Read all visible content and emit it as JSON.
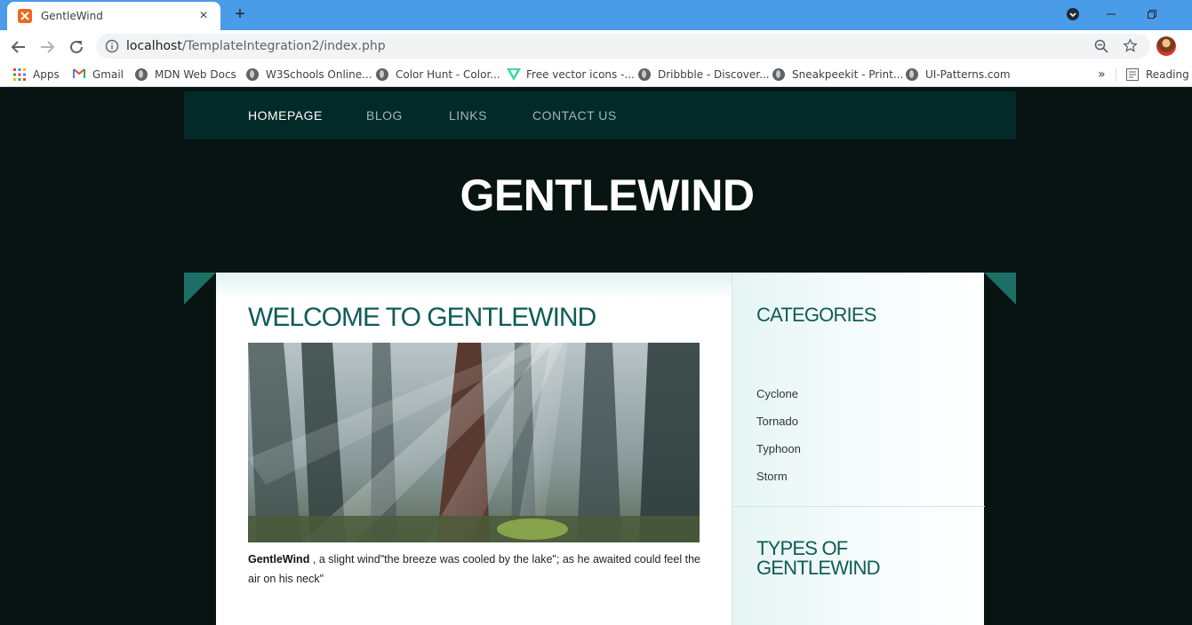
{
  "browser": {
    "tab_title": "GentleWind",
    "url_host": "localhost",
    "url_path": "/TemplateIntegration2/index.php",
    "bookmarks": [
      {
        "label": "Apps",
        "icon": "apps-grid-icon"
      },
      {
        "label": "Gmail",
        "icon": "gmail-icon"
      },
      {
        "label": "MDN Web Docs",
        "icon": "globe-icon"
      },
      {
        "label": "W3Schools Online...",
        "icon": "globe-icon"
      },
      {
        "label": "Color Hunt - Color...",
        "icon": "globe-icon"
      },
      {
        "label": "Free vector icons -...",
        "icon": "vector-icon"
      },
      {
        "label": "Dribbble - Discover...",
        "icon": "globe-icon"
      },
      {
        "label": "Sneakpeekit - Print...",
        "icon": "globe-icon"
      },
      {
        "label": "UI-Patterns.com",
        "icon": "globe-icon"
      }
    ],
    "more_bookmarks": "»",
    "reading_list": "Reading li"
  },
  "site": {
    "nav": [
      "HOMEPAGE",
      "BLOG",
      "LINKS",
      "CONTACT US"
    ],
    "title": "GENTLEWIND",
    "main": {
      "heading": "WELCOME TO GENTLEWIND",
      "caption_bold": "GentleWind",
      "caption_text": " , a slight wind\"the breeze was cooled by the lake\"; as he awaited could feel the air on his neck\""
    },
    "sidebar": {
      "categories_heading": "CATEGORIES",
      "categories": [
        "Cyclone",
        "Tornado",
        "Typhoon",
        "Storm"
      ],
      "types_heading_line1": "TYPES OF",
      "types_heading_line2": "GENTLEWIND"
    }
  },
  "colors": {
    "browser_tabbar": "#4a9be8",
    "page_bg": "#071412",
    "nav_bg": "#022a28",
    "accent": "#0f5c56",
    "ribbon": "#1c6f66"
  }
}
